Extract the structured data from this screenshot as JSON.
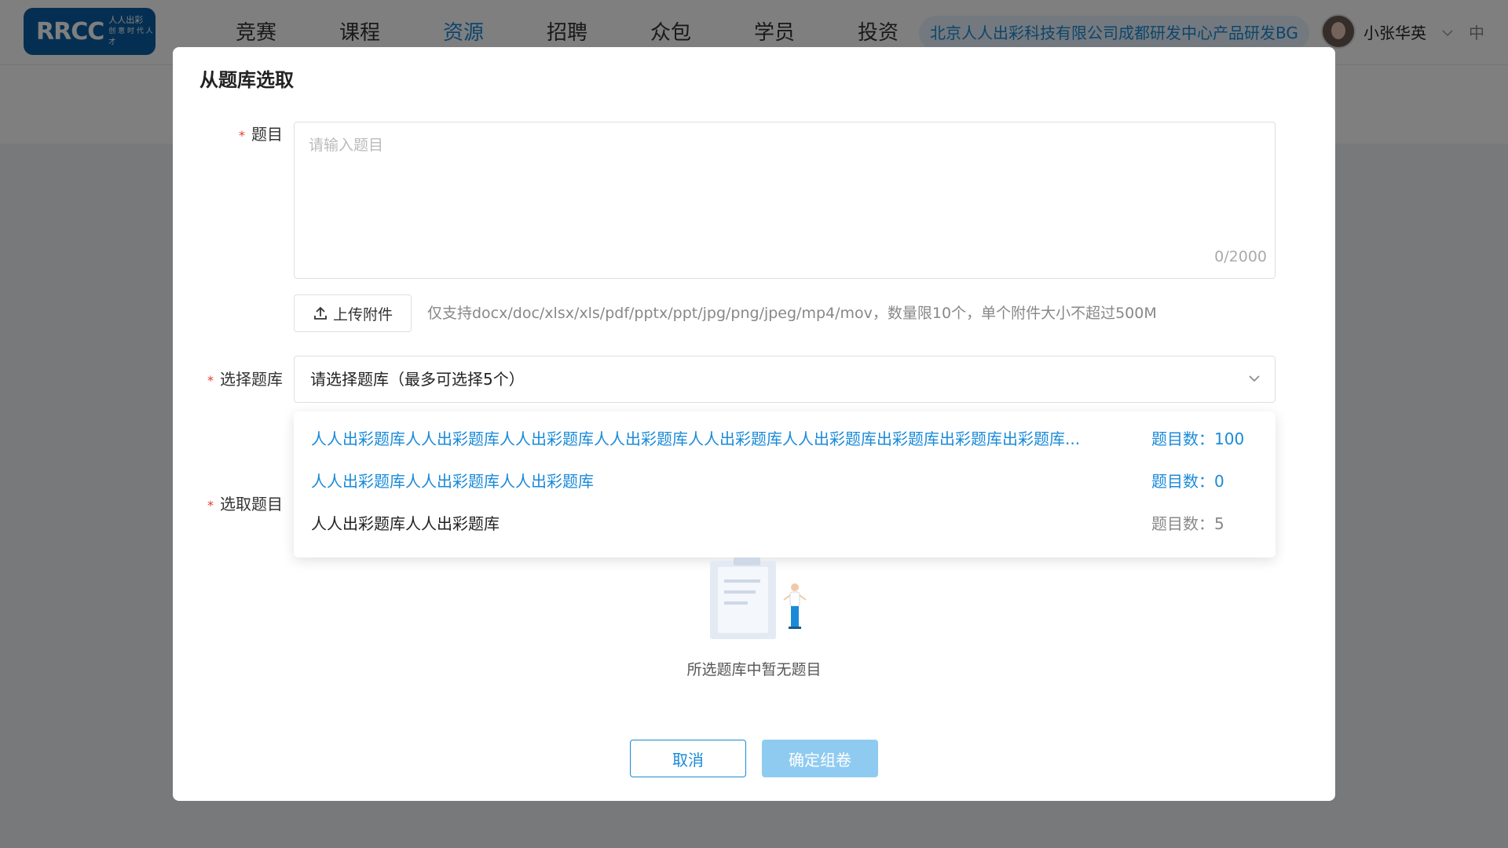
{
  "header": {
    "logo_main": "RRCC",
    "logo_sub1": "人人出彩",
    "logo_sub2": "创 意 时 代 人 才",
    "nav": [
      "竞赛",
      "课程",
      "资源",
      "招聘",
      "众包",
      "学员",
      "投资"
    ],
    "active_nav": "资源",
    "company": "北京人人出彩科技有限公司成都研发中心产品研发BG",
    "username": "小张华英",
    "lang": "中"
  },
  "modal": {
    "title": "从题库选取",
    "question": {
      "label": "题目",
      "placeholder": "请输入题目",
      "counter": "0/2000"
    },
    "upload": {
      "button": "上传附件",
      "hint": "仅支持docx/doc/xlsx/xls/pdf/pptx/ppt/jpg/png/jpeg/mp4/mov，数量限10个，单个附件大小不超过500M"
    },
    "bank": {
      "label": "选择题库",
      "value": "请选择题库（最多可选择5个）",
      "options": [
        {
          "name": "人人出彩题库人人出彩题库人人出彩题库人人出彩题库人人出彩题库人人出彩题库出彩题库出彩题库出彩题库...",
          "count": "题目数：100",
          "selected": true
        },
        {
          "name": "人人出彩题库人人出彩题库人人出彩题库",
          "count": "题目数：0",
          "selected": true
        },
        {
          "name": "人人出彩题库人人出彩题库",
          "count": "题目数：5",
          "selected": false
        }
      ]
    },
    "pick": {
      "label": "选取题目",
      "empty_text": "所选题库中暂无题目"
    },
    "cancel": "取消",
    "confirm": "确定组卷"
  },
  "colors": {
    "accent": "#1a8ad8",
    "confirm_disabled": "#8fcbf0",
    "required": "#e53935"
  }
}
